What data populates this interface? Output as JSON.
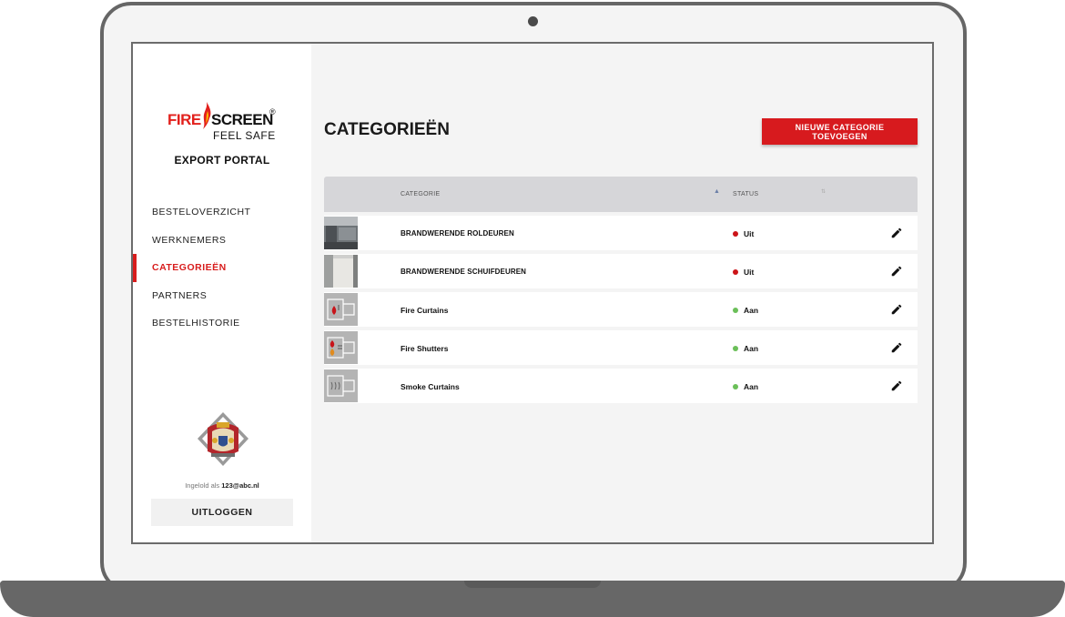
{
  "brand": {
    "logo_fire": "FIRE",
    "logo_screen": "SCREEN",
    "logo_reg": "®",
    "logo_tagline": "FEEL SAFE",
    "portal_title": "EXPORT PORTAL",
    "accent_color": "#d71a1e"
  },
  "sidebar": {
    "items": [
      {
        "label": "BESTELOVERZICHT",
        "active": false
      },
      {
        "label": "WERKNEMERS",
        "active": false
      },
      {
        "label": "CATEGORIEËN",
        "active": true
      },
      {
        "label": "PARTNERS",
        "active": false
      },
      {
        "label": "BESTELHISTORIE",
        "active": false
      }
    ],
    "login_prefix": "Ingelold als",
    "login_user": "123@abc.nl",
    "logout_label": "UITLOGGEN"
  },
  "main": {
    "title": "CATEGORIEËN",
    "add_button_label": "NIEUWE CATEGORIE TOEVOEGEN",
    "table": {
      "headers": {
        "category": "CATEGORIE",
        "status": "STATUS"
      },
      "rows": [
        {
          "name": "BRANDWERENDE ROLDEUREN",
          "status": "Uit",
          "thumb": "roller-door-photo"
        },
        {
          "name": "BRANDWERENDE SCHUIFDEUREN",
          "status": "Uit",
          "thumb": "sliding-door-photo"
        },
        {
          "name": "Fire Curtains",
          "status": "Aan",
          "thumb": "fire-curtain-diagram"
        },
        {
          "name": "Fire Shutters",
          "status": "Aan",
          "thumb": "fire-shutter-diagram"
        },
        {
          "name": "Smoke Curtains",
          "status": "Aan",
          "thumb": "smoke-curtain-diagram"
        }
      ]
    }
  }
}
